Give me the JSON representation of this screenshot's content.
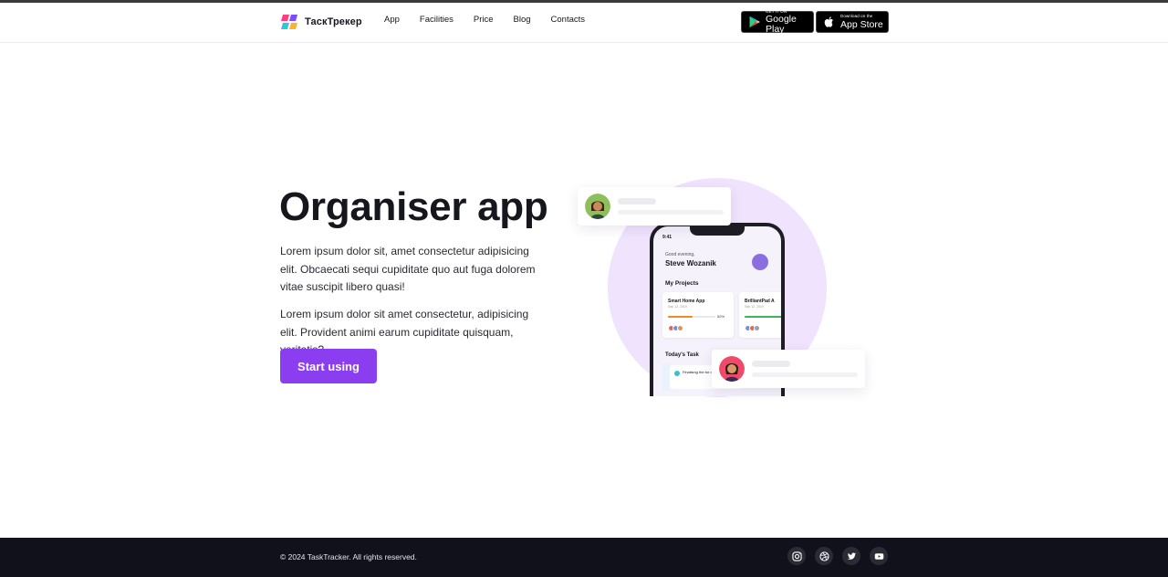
{
  "header": {
    "brand": "ТаскТрекер",
    "nav": [
      "App",
      "Facilities",
      "Price",
      "Blog",
      "Contacts"
    ],
    "google_play": {
      "small": "GET IT ON",
      "big": "Google Play"
    },
    "app_store": {
      "small": "Download on the",
      "big": "App Store"
    }
  },
  "hero": {
    "title": "Organiser app",
    "paragraph1": "Lorem ipsum dolor sit, amet consectetur adipisicing elit. Obcaecati sequi cupiditate quo aut fuga dolorem vitae suscipit libero quasi!",
    "paragraph2": "Lorem ipsum dolor sit amet consectetur, adipisicing elit. Provident animi earum cupiditate quisquam, veritatis?",
    "cta_label": "Start using"
  },
  "phone": {
    "time": "9:41",
    "greeting": "Good evening,",
    "name": "Steve Wozanik",
    "projects_heading": "My Projects",
    "projects": [
      {
        "title": "Smart Home App",
        "date": "Sep 12, 2019",
        "percent": "52%",
        "progress": 0.52,
        "color": "#f08a24"
      },
      {
        "title": "BrilliantPad A",
        "date": "Sep 12, 2019",
        "percent": "",
        "progress": 1.0,
        "color": "#3cb45c"
      }
    ],
    "today_heading": "Today's Task",
    "task_text": "Finalising the for developm"
  },
  "footer": {
    "copyright": "© 2024 TaskTracker. All rights reserved.",
    "socials": [
      "instagram-icon",
      "dribbble-icon",
      "twitter-icon",
      "youtube-icon"
    ]
  },
  "colors": {
    "accent": "#8b3ef0",
    "footer_bg": "#10111a",
    "circle": "#efe3fe"
  }
}
